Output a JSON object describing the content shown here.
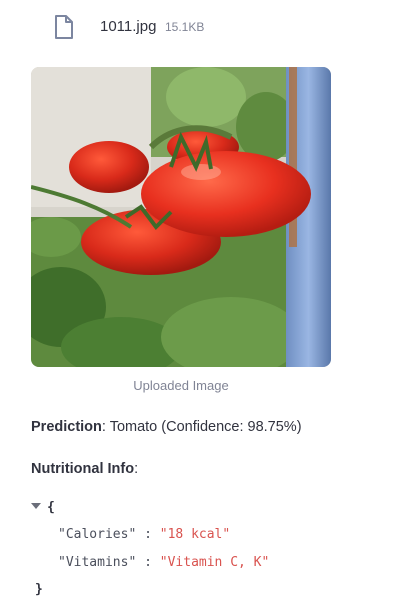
{
  "file": {
    "name": "1011.jpg",
    "size": "15.1KB",
    "icon": "file-icon"
  },
  "image": {
    "caption": "Uploaded Image"
  },
  "prediction": {
    "label": "Prediction",
    "text": ": Tomato (Confidence: 98.75%)"
  },
  "nutrition": {
    "label": "Nutritional Info",
    "suffix": ":",
    "open_brace": "{",
    "close_brace": "}",
    "entries": [
      {
        "key": "\"Calories\"",
        "value": "\"18 kcal\""
      },
      {
        "key": "\"Vitamins\"",
        "value": "\"Vitamin C, K\""
      }
    ],
    "colon": ":"
  },
  "colors": {
    "text": "#31333f",
    "muted": "#808495",
    "json_value": "#d9534f"
  }
}
